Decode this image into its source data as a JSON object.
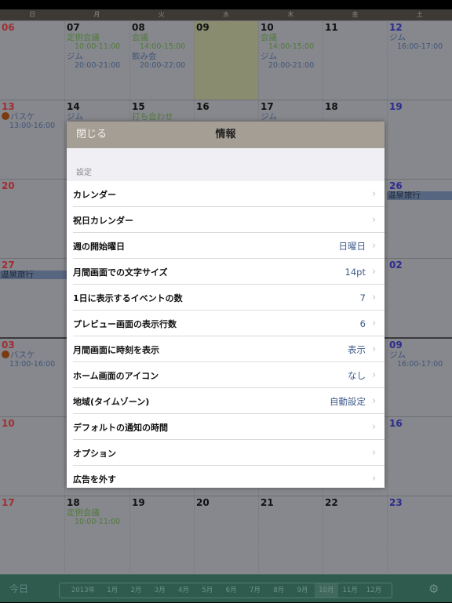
{
  "weekdays": [
    "日",
    "月",
    "火",
    "水",
    "木",
    "金",
    "土"
  ],
  "weeks": [
    {
      "days": [
        {
          "d": "06",
          "kind": "sun",
          "events": []
        },
        {
          "d": "07",
          "events": [
            {
              "title": "定例会議",
              "time": "10:00-11:00",
              "color": "green"
            },
            {
              "title": "ジム",
              "time": "20:00-21:00",
              "color": "blue"
            }
          ]
        },
        {
          "d": "08",
          "events": [
            {
              "title": "会議",
              "time": "14:00-15:00",
              "color": "green"
            },
            {
              "title": "飲み会",
              "time": "20:00-22:00",
              "color": "blue"
            }
          ]
        },
        {
          "d": "09",
          "today": true,
          "events": []
        },
        {
          "d": "10",
          "events": [
            {
              "title": "会議",
              "time": "14:00-15:00",
              "color": "green"
            },
            {
              "title": "ジム",
              "time": "20:00-21:00",
              "color": "blue"
            }
          ]
        },
        {
          "d": "11",
          "events": []
        },
        {
          "d": "12",
          "kind": "sat",
          "events": [
            {
              "title": "ジム",
              "time": "16:00-17:00",
              "color": "blue"
            }
          ]
        }
      ]
    },
    {
      "days": [
        {
          "d": "13",
          "kind": "sun",
          "events": [
            {
              "title": "バスケ",
              "time": "13:00-16:00",
              "color": "blue",
              "icon": "basketball-icon"
            }
          ]
        },
        {
          "d": "14",
          "events": [
            {
              "title": "ジム",
              "color": "blue"
            }
          ]
        },
        {
          "d": "15",
          "events": [
            {
              "title": "打ち合わせ",
              "color": "green"
            }
          ]
        },
        {
          "d": "16",
          "events": []
        },
        {
          "d": "17",
          "events": [
            {
              "title": "ジム",
              "color": "blue"
            }
          ]
        },
        {
          "d": "18",
          "events": []
        },
        {
          "d": "19",
          "kind": "sat",
          "events": []
        }
      ]
    },
    {
      "days": [
        {
          "d": "20",
          "kind": "sun",
          "events": []
        },
        {
          "d": "",
          "events": []
        },
        {
          "d": "",
          "events": []
        },
        {
          "d": "",
          "events": []
        },
        {
          "d": "",
          "events": []
        },
        {
          "d": "",
          "events": []
        },
        {
          "d": "26",
          "kind": "sat",
          "events": []
        }
      ],
      "bar": {
        "title": "温泉旅行",
        "from": 6,
        "to": 6
      }
    },
    {
      "days": [
        {
          "d": "27",
          "kind": "sun",
          "events": []
        },
        {
          "d": "",
          "events": []
        },
        {
          "d": "",
          "events": []
        },
        {
          "d": "",
          "events": []
        },
        {
          "d": "",
          "events": []
        },
        {
          "d": "",
          "events": []
        },
        {
          "d": "02",
          "kind": "sat",
          "events": []
        }
      ],
      "bar": {
        "title": "温泉旅行",
        "from": 0,
        "to": 1
      }
    },
    {
      "thick": true,
      "days": [
        {
          "d": "03",
          "kind": "sun",
          "events": [
            {
              "title": "バスケ",
              "time": "13:00-16:00",
              "color": "blue",
              "icon": "basketball-icon"
            }
          ]
        },
        {
          "d": "",
          "events": []
        },
        {
          "d": "",
          "events": []
        },
        {
          "d": "",
          "events": []
        },
        {
          "d": "",
          "events": []
        },
        {
          "d": "",
          "events": []
        },
        {
          "d": "09",
          "kind": "sat",
          "events": [
            {
              "title": "ジム",
              "time": "16:00-17:00",
              "color": "blue"
            }
          ]
        }
      ]
    },
    {
      "days": [
        {
          "d": "10",
          "kind": "sun",
          "events": []
        },
        {
          "d": "",
          "events": []
        },
        {
          "d": "",
          "events": []
        },
        {
          "d": "",
          "events": []
        },
        {
          "d": "",
          "events": []
        },
        {
          "d": "",
          "events": []
        },
        {
          "d": "16",
          "kind": "sat",
          "events": []
        }
      ]
    },
    {
      "days": [
        {
          "d": "17",
          "kind": "sun",
          "events": []
        },
        {
          "d": "18",
          "events": [
            {
              "title": "定例会議",
              "time": "10:00-11:00",
              "color": "green"
            }
          ]
        },
        {
          "d": "19",
          "events": []
        },
        {
          "d": "20",
          "events": []
        },
        {
          "d": "21",
          "events": []
        },
        {
          "d": "22",
          "events": []
        },
        {
          "d": "23",
          "kind": "sat",
          "events": []
        }
      ]
    }
  ],
  "modal": {
    "close_label": "閉じる",
    "title": "情報",
    "section": "設定",
    "rows": [
      {
        "label": "カレンダー",
        "value": ""
      },
      {
        "label": "祝日カレンダー",
        "value": ""
      },
      {
        "label": "週の開始曜日",
        "value": "日曜日"
      },
      {
        "label": "月間画面での文字サイズ",
        "value": "14pt"
      },
      {
        "label": "1日に表示するイベントの数",
        "value": "7"
      },
      {
        "label": "プレビュー画面の表示行数",
        "value": "6"
      },
      {
        "label": "月間画面に時刻を表示",
        "value": "表示"
      },
      {
        "label": "ホーム画面のアイコン",
        "value": "なし"
      },
      {
        "label": "地域(タイムゾーン)",
        "value": "自動設定"
      },
      {
        "label": "デフォルトの通知の時間",
        "value": ""
      },
      {
        "label": "オプション",
        "value": ""
      },
      {
        "label": "広告を外す",
        "value": ""
      }
    ]
  },
  "toolbar": {
    "today_label": "今日",
    "year": "2013年",
    "months": [
      "1月",
      "2月",
      "3月",
      "4月",
      "5月",
      "6月",
      "7月",
      "8月",
      "9月",
      "10月",
      "11月",
      "12月"
    ],
    "selected_month": "10月",
    "settings_icon": "gear-icon"
  },
  "colors": {
    "today_bg": "#898c6e",
    "modal_header": "#a59e94",
    "toolbar": "#2f5b4f",
    "value_text": "#3f5b8c"
  }
}
